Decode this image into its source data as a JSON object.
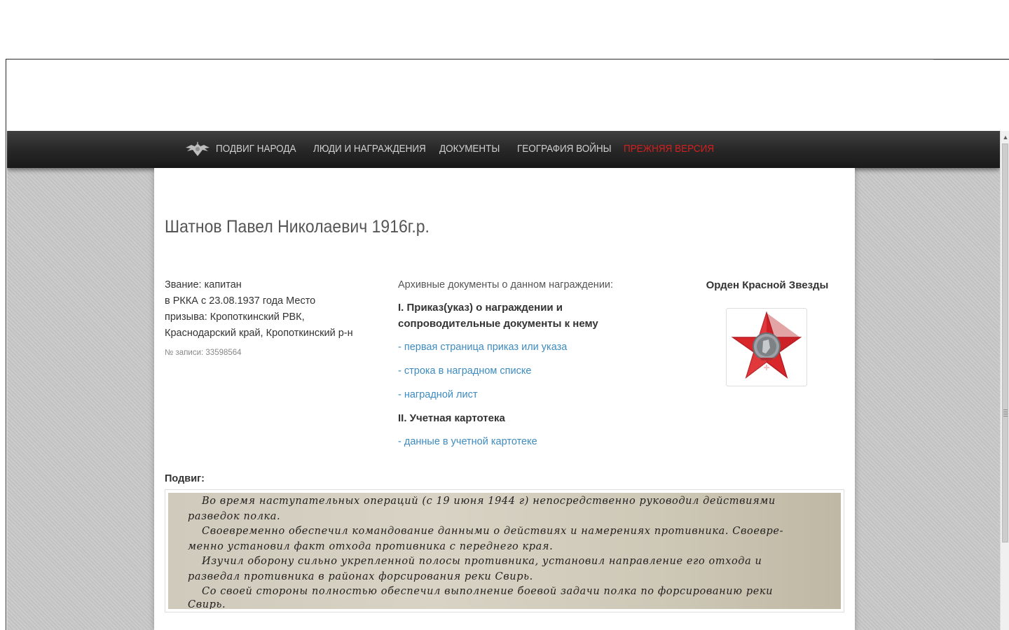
{
  "nav": {
    "items": [
      {
        "label": "ПОДВИГ НАРОДА"
      },
      {
        "label": "ЛЮДИ И НАГРАЖДЕНИЯ"
      },
      {
        "label": "ДОКУМЕНТЫ"
      },
      {
        "label": "ГЕОГРАФИЯ ВОЙНЫ"
      },
      {
        "label": "ПРЕЖНЯЯ ВЕРСИЯ"
      }
    ]
  },
  "person": {
    "name": "Шатнов Павел Николаевич 1916г.р.",
    "rank": "Звание: капитан",
    "details_1": "в РККА с 23.08.1937 года Место",
    "details_2": "призыва: Кропоткинский РВК,",
    "details_3": "Краснодарский край, Кропоткинский р-н",
    "record_no": "№ записи: 33598564"
  },
  "archive": {
    "title": "Архивные документы о данном награждении:",
    "section1_line1": "I. Приказ(указ) о награждении и",
    "section1_line2": "сопроводительные документы к нему",
    "links1": [
      {
        "label": "- первая страница приказ или указа"
      },
      {
        "label": "- строка в наградном списке"
      },
      {
        "label": "- наградной лист"
      }
    ],
    "section2": "II. Учетная картотека",
    "links2": [
      {
        "label": "- данные в учетной картотеке"
      }
    ]
  },
  "award": {
    "name": "Орден Красной Звезды",
    "colors": {
      "star": "#d9262b",
      "center": "#8a8f94"
    }
  },
  "feat": {
    "label": "Подвиг:",
    "lines": [
      "Во время наступательных операций (с 19 июня 1944 г) непосредственно руководил действиями",
      "разведок полка.",
      "Своевременно обеспечил командование данными о действиях и намерениях противника. Своевре-",
      "менно установил факт отхода противника с переднего края.",
      "Изучил оборону сильно укрепленной полосы противника, установил направление его отхода и",
      "разведал противника в районах форсирования реки Свирь.",
      "Со своей стороны полностью обеспечил выполнение боевой задачи полка по форсированию реки",
      "Свирь."
    ]
  },
  "theme": {
    "nav_text": "#cfcfcf",
    "nav_old_version": "#d21f1f",
    "link": "#3d8bbf"
  }
}
